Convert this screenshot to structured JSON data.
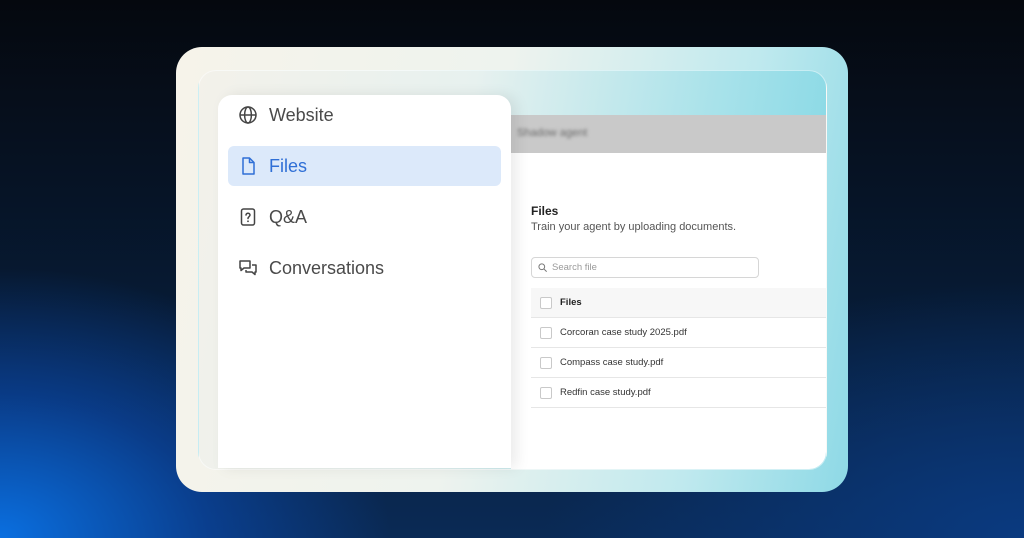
{
  "sidebar": {
    "items": [
      {
        "label": "Website",
        "icon": "globe-icon",
        "active": false
      },
      {
        "label": "Files",
        "icon": "file-icon",
        "active": true
      },
      {
        "label": "Q&A",
        "icon": "question-file-icon",
        "active": false
      },
      {
        "label": "Conversations",
        "icon": "chat-bubbles-icon",
        "active": false
      }
    ]
  },
  "header": {
    "agent_selector": "Shadow agent"
  },
  "main": {
    "title": "Files",
    "subtitle": "Train your agent by uploading documents.",
    "search": {
      "placeholder": "Search file",
      "value": ""
    },
    "table": {
      "column_header": "Files",
      "rows": [
        "Corcoran case study 2025.pdf",
        "Compass case study.pdf",
        "Redfin case study.pdf"
      ]
    }
  },
  "colors": {
    "active_nav_bg": "#dce9fa",
    "active_nav_text": "#2f6fd6",
    "nav_text": "#4a4a4a",
    "topbar": "#c9c9c9"
  }
}
